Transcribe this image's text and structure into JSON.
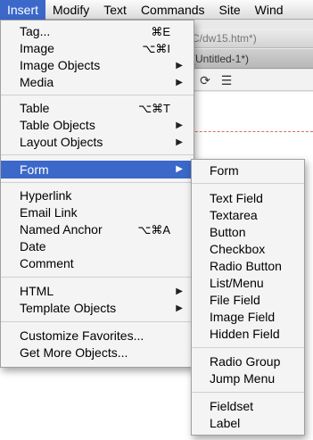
{
  "menubar": {
    "items": [
      "Insert",
      "Modify",
      "Text",
      "Commands",
      "Site",
      "Wind"
    ]
  },
  "background": {
    "title_fragment": "C/dw15.htm*)",
    "tab_fragment": "(Untitled-1*)"
  },
  "insert_menu": {
    "items": [
      {
        "label": "Tag...",
        "shortcut": "⌘E"
      },
      {
        "label": "Image",
        "shortcut": "⌥⌘I"
      },
      {
        "label": "Image Objects"
      },
      {
        "label": "Media"
      },
      {
        "label": "Table",
        "shortcut": "⌥⌘T"
      },
      {
        "label": "Table Objects"
      },
      {
        "label": "Layout Objects"
      },
      {
        "label": "Form"
      },
      {
        "label": "Hyperlink"
      },
      {
        "label": "Email Link"
      },
      {
        "label": "Named Anchor",
        "shortcut": "⌥⌘A"
      },
      {
        "label": "Date"
      },
      {
        "label": "Comment"
      },
      {
        "label": "HTML"
      },
      {
        "label": "Template Objects"
      },
      {
        "label": "Customize Favorites..."
      },
      {
        "label": "Get More Objects..."
      }
    ]
  },
  "form_submenu": {
    "items": [
      "Form",
      "Text Field",
      "Textarea",
      "Button",
      "Checkbox",
      "Radio Button",
      "List/Menu",
      "File Field",
      "Image Field",
      "Hidden Field",
      "Radio Group",
      "Jump Menu",
      "Fieldset",
      "Label"
    ]
  },
  "icons": {
    "submenu_arrow": "▶",
    "refresh": "⟳",
    "list": "☰"
  },
  "colors": {
    "highlight": "#3b68c9",
    "menu_bg": "#f4f4f4"
  }
}
